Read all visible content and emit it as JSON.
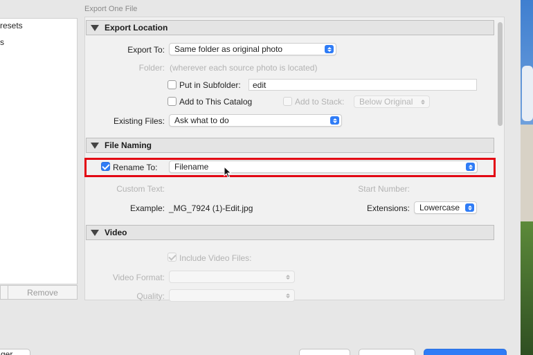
{
  "window": {
    "title": "Export One File"
  },
  "presets": {
    "items": [
      "resets",
      "s"
    ],
    "remove_label": "Remove"
  },
  "sections": {
    "export_location": {
      "title": "Export Location",
      "export_to_label": "Export To:",
      "export_to_value": "Same folder as original photo",
      "folder_label": "Folder:",
      "folder_value": "(wherever each source photo is located)",
      "subfolder_label": "Put in Subfolder:",
      "subfolder_value": "edit",
      "add_catalog_label": "Add to This Catalog",
      "add_stack_label": "Add to Stack:",
      "stack_value": "Below Original",
      "existing_files_label": "Existing Files:",
      "existing_files_value": "Ask what to do"
    },
    "file_naming": {
      "title": "File Naming",
      "rename_label": "Rename To:",
      "rename_value": "Filename",
      "custom_text_label": "Custom Text:",
      "start_number_label": "Start Number:",
      "example_label": "Example:",
      "example_value": "_MG_7924 (1)-Edit.jpg",
      "extensions_label": "Extensions:",
      "extensions_value": "Lowercase"
    },
    "video": {
      "title": "Video",
      "include_label": "Include Video Files:",
      "format_label": "Video Format:",
      "quality_label": "Quality:"
    }
  },
  "bottom": {
    "left_button": "ger"
  },
  "colors": {
    "accent": "#2f7cf6",
    "highlight": "#e30613"
  }
}
